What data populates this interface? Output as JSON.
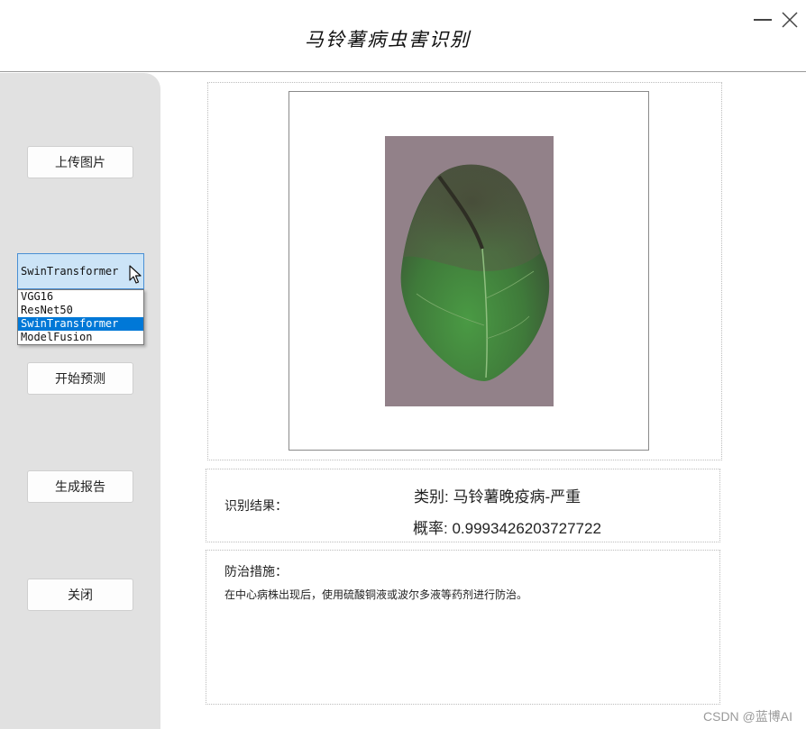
{
  "window": {
    "title": "马铃薯病虫害识别",
    "minimize_icon": "minimize-icon",
    "close_icon": "close-icon"
  },
  "sidebar": {
    "upload_label": "上传图片",
    "model_select": {
      "value": "SwinTransformer",
      "options": [
        "VGG16",
        "ResNet50",
        "SwinTransformer",
        "ModelFusion"
      ],
      "selected_index": 2
    },
    "predict_label": "开始预测",
    "report_label": "生成报告",
    "close_label": "关闭"
  },
  "result": {
    "label": "识别结果：",
    "class_text": "类别: 马铃薯晚疫病-严重",
    "prob_text": "概率: 0.9993426203727722"
  },
  "measures": {
    "title": "防治措施：",
    "text": "在中心病株出现后，使用硫酸铜液或波尔多液等药剂进行防治。"
  },
  "watermark": "CSDN @蓝博AI",
  "colors": {
    "sidebar_bg": "#e1e1e1",
    "combo_bg": "#cce4f7",
    "combo_border": "#4a8fd4",
    "selected_option": "#0078d7"
  }
}
